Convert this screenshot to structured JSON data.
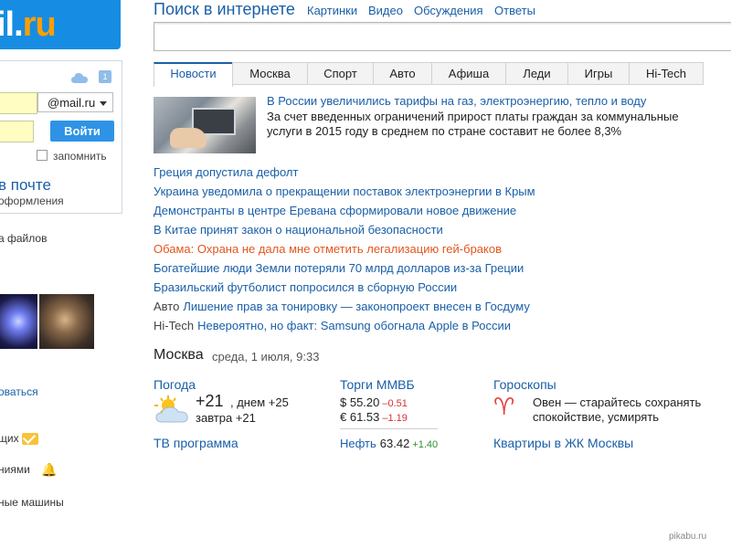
{
  "left": {
    "logo_text": "il.",
    "logo_accent": "ru",
    "calendar_day": "1",
    "domain_value": "@mail.ru",
    "login_button": "Войти",
    "remember_label": "запомнить",
    "promo_title": "в почте",
    "promo_subtitle": "оформления",
    "files_text": "а файлов",
    "link_text": "оваться",
    "messages_text": "щих",
    "notifications_text": "ниями",
    "cars_text": "ные машины"
  },
  "search": {
    "title": "Поиск в интернете",
    "links": [
      "Картинки",
      "Видео",
      "Обсуждения",
      "Ответы"
    ]
  },
  "tabs": [
    "Новости",
    "Москва",
    "Спорт",
    "Авто",
    "Афиша",
    "Леди",
    "Игры",
    "Hi-Tech"
  ],
  "headline": {
    "title": "В России увеличились тарифы на газ, электроэнергию, тепло и воду",
    "description": "За счет введенных ограничений прирост платы граждан за коммунальные услуги в 2015 году в среднем по стране составит не более 8,3%"
  },
  "news": [
    {
      "tag": "",
      "text": "Греция допустила дефолт"
    },
    {
      "tag": "",
      "text": "Украина уведомила о прекращении поставок электроэнергии в Крым"
    },
    {
      "tag": "",
      "text": "Демонстранты в центре Еревана сформировали новое движение"
    },
    {
      "tag": "",
      "text": "В Китае принят закон о национальной безопасности"
    },
    {
      "tag": "",
      "text": "Обама: Охрана не дала мне отметить легализацию гей-браков"
    },
    {
      "tag": "",
      "text": "Богатейшие люди Земли потеряли 70 млрд долларов из-за Греции"
    },
    {
      "tag": "",
      "text": "Бразильский футболист попросился в сборную России"
    },
    {
      "tag": "Авто",
      "text": "Лишение прав за тонировку — законопроект внесен в Госдуму"
    },
    {
      "tag": "Hi-Tech",
      "text": "Невероятно, но факт: Samsung обогнала Apple в России"
    }
  ],
  "city": {
    "name": "Москва",
    "date": "среда, 1 июля, 9:33"
  },
  "weather": {
    "title": "Погода",
    "now": "+21",
    "day": ", днем +25",
    "tomorrow": "завтра +21"
  },
  "market": {
    "title": "Торги ММВБ",
    "usd": "$  55.20",
    "usd_change": "–0.51",
    "eur": "€  61.53",
    "eur_change": "–1.19",
    "oil_label": "Нефть",
    "oil_value": "63.42",
    "oil_change": "+1.40"
  },
  "horoscope": {
    "title": "Гороскопы",
    "text": "Овен — старайтесь сохранять спокойствие, усмирять"
  },
  "bottom_links": {
    "tv": "ТВ программа",
    "apartments": "Квартиры в ЖК Москвы"
  },
  "watermark": "pikabu.ru",
  "colors": {
    "brand_blue": "#168de2",
    "brand_orange": "#ff9e00",
    "link": "#1a5fa8",
    "hot": "#e3561f"
  }
}
